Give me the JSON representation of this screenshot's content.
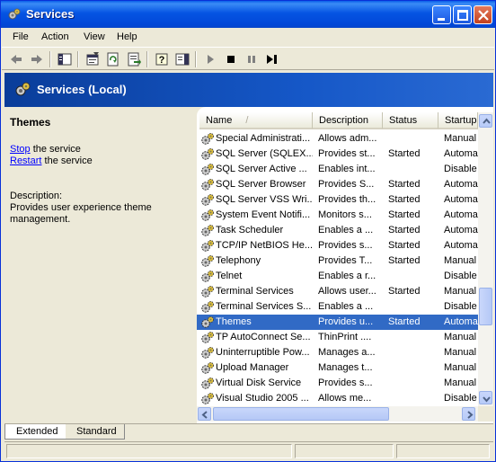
{
  "window": {
    "title": "Services"
  },
  "menu": [
    {
      "label": "File"
    },
    {
      "label": "Action"
    },
    {
      "label": "View"
    },
    {
      "label": "Help"
    }
  ],
  "header": {
    "title": "Services (Local)"
  },
  "details": {
    "service_name": "Themes",
    "stop_link": "Stop",
    "stop_suffix": " the service",
    "restart_link": "Restart",
    "restart_suffix": " the service",
    "description_label": "Description:",
    "description_text": "Provides user experience theme management."
  },
  "columns": {
    "name": "Name",
    "sort_arrow": "/",
    "description": "Description",
    "status": "Status",
    "startup": "Startup"
  },
  "services": [
    {
      "name": "Special Administrati...",
      "description": "Allows adm...",
      "status": "",
      "startup": "Manual"
    },
    {
      "name": "SQL Server (SQLEX...",
      "description": "Provides st...",
      "status": "Started",
      "startup": "Automa"
    },
    {
      "name": "SQL Server Active ...",
      "description": "Enables int...",
      "status": "",
      "startup": "Disable"
    },
    {
      "name": "SQL Server Browser",
      "description": "Provides S...",
      "status": "Started",
      "startup": "Automa"
    },
    {
      "name": "SQL Server VSS Wri...",
      "description": "Provides th...",
      "status": "Started",
      "startup": "Automa"
    },
    {
      "name": "System Event Notifi...",
      "description": "Monitors s...",
      "status": "Started",
      "startup": "Automa"
    },
    {
      "name": "Task Scheduler",
      "description": "Enables a ...",
      "status": "Started",
      "startup": "Automa"
    },
    {
      "name": "TCP/IP NetBIOS He...",
      "description": "Provides s...",
      "status": "Started",
      "startup": "Automa"
    },
    {
      "name": "Telephony",
      "description": "Provides T...",
      "status": "Started",
      "startup": "Manual"
    },
    {
      "name": "Telnet",
      "description": "Enables a r...",
      "status": "",
      "startup": "Disable"
    },
    {
      "name": "Terminal Services",
      "description": "Allows user...",
      "status": "Started",
      "startup": "Manual"
    },
    {
      "name": "Terminal Services S...",
      "description": "Enables a ...",
      "status": "",
      "startup": "Disable"
    },
    {
      "name": "Themes",
      "description": "Provides u...",
      "status": "Started",
      "startup": "Automa",
      "selected": true
    },
    {
      "name": "TP AutoConnect Se...",
      "description": "ThinPrint ....",
      "status": "",
      "startup": "Manual"
    },
    {
      "name": "Uninterruptible Pow...",
      "description": "Manages a...",
      "status": "",
      "startup": "Manual"
    },
    {
      "name": "Upload Manager",
      "description": "Manages t...",
      "status": "",
      "startup": "Manual"
    },
    {
      "name": "Virtual Disk Service",
      "description": "Provides s...",
      "status": "",
      "startup": "Manual"
    },
    {
      "name": "Visual Studio 2005 ...",
      "description": "Allows me...",
      "status": "",
      "startup": "Disable"
    }
  ],
  "tabs": [
    {
      "label": "Extended",
      "active": true
    },
    {
      "label": "Standard",
      "active": false
    }
  ],
  "colors": {
    "title_bar": "#0554e3",
    "selection": "#316ac5",
    "header_band": "#1557c7"
  }
}
